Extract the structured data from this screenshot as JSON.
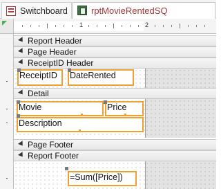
{
  "tabs": [
    {
      "label": "Switchboard",
      "icon": "form-icon",
      "active": false
    },
    {
      "label": "rptMovieRentedSQ",
      "icon": "report-icon",
      "active": true
    }
  ],
  "ruler": {
    "numbers": [
      "1",
      "2"
    ]
  },
  "sections": {
    "report_header": "Report Header",
    "page_header": "Page Header",
    "group_header": "ReceiptID Header",
    "detail": "Detail",
    "page_footer": "Page Footer",
    "report_footer": "Report Footer"
  },
  "controls": {
    "receipt": "ReceiptID",
    "date_rented": "DateRented",
    "movie": "Movie",
    "price": "Price",
    "description": "Description",
    "sum_price": "=Sum([Price])"
  },
  "colors": {
    "selection": "#f0a030",
    "active_tab_text": "#a4373a"
  }
}
